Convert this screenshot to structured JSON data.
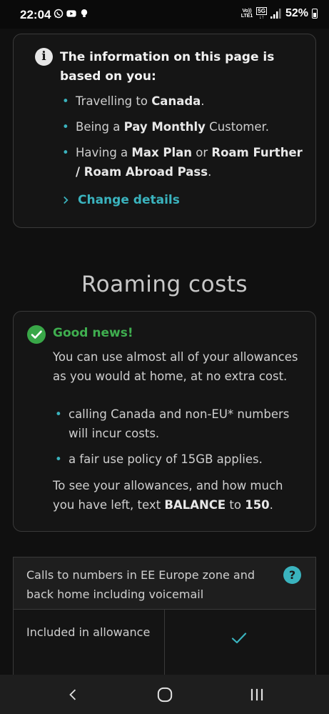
{
  "status_bar": {
    "time": "22:04",
    "volte": "Vo))",
    "lte": "LTE1",
    "network": "5G",
    "battery": "52%",
    "icons": [
      "whatsapp-icon",
      "youtube-icon",
      "bulb-icon",
      "signal-icon",
      "battery-icon"
    ]
  },
  "info": {
    "title": "The information on this page is based on you:",
    "bullets": [
      {
        "pre": "Travelling to ",
        "bold": "Canada",
        "post": "."
      },
      {
        "pre": "Being a ",
        "bold": "Pay Monthly",
        "post": " Customer."
      },
      {
        "pre": "Having a ",
        "bold": "Max Plan",
        "mid": " or ",
        "bold2": "Roam Further / Roam Abroad Pass",
        "post": "."
      }
    ],
    "change_link": "Change details"
  },
  "section": {
    "title": "Roaming costs"
  },
  "good_news": {
    "title": "Good news!",
    "body": "You can use almost all of your allowances as you would at home, at no extra cost.",
    "bullets": [
      "calling Canada and non-EU* numbers will incur costs.",
      "a fair use policy of 15GB applies."
    ],
    "footer": {
      "pre": "To see your allowances, and how much you have left, text ",
      "bold": "BALANCE",
      "mid": " to ",
      "bold2": "150",
      "post": "."
    }
  },
  "table": {
    "header": "Calls to numbers in EE Europe zone and back home including voicemail",
    "help": "?",
    "row_label": "Included in allowance",
    "row_value": "check-icon"
  },
  "colors": {
    "accent": "#3ab3be",
    "success": "#39a748",
    "background": "#101010",
    "card": "#151515"
  }
}
